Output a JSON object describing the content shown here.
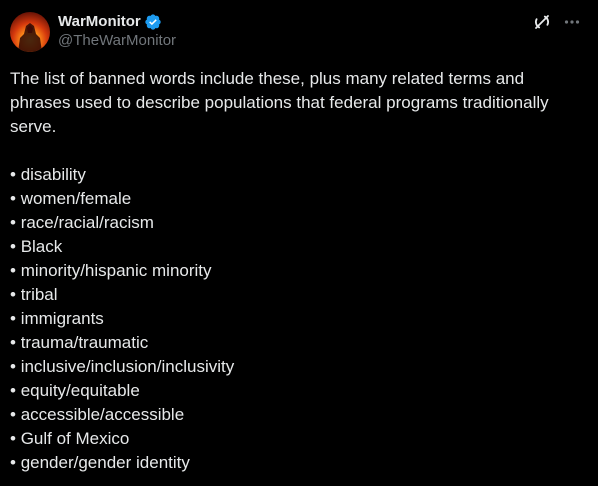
{
  "author": {
    "display_name": "WarMonitor",
    "handle": "@TheWarMonitor",
    "verified": true,
    "verified_color": "#1d9bf0"
  },
  "tweet": {
    "intro": "The list of banned words include these, plus many related terms and phrases used to describe populations that federal programs traditionally serve.",
    "items": [
      "disability",
      "women/female",
      "race/racial/racism",
      "Black",
      "minority/hispanic minority",
      "tribal",
      "immigrants",
      "trauma/traumatic",
      "inclusive/inclusion/inclusivity",
      "equity/equitable",
      "accessible/accessible",
      "Gulf of Mexico",
      "gender/gender identity"
    ]
  },
  "icons": {
    "grok": "grok-icon",
    "more": "more-icon",
    "verified": "verified-badge-icon"
  },
  "colors": {
    "background": "#000000",
    "text": "#e7e9ea",
    "secondary_text": "#71767b"
  }
}
